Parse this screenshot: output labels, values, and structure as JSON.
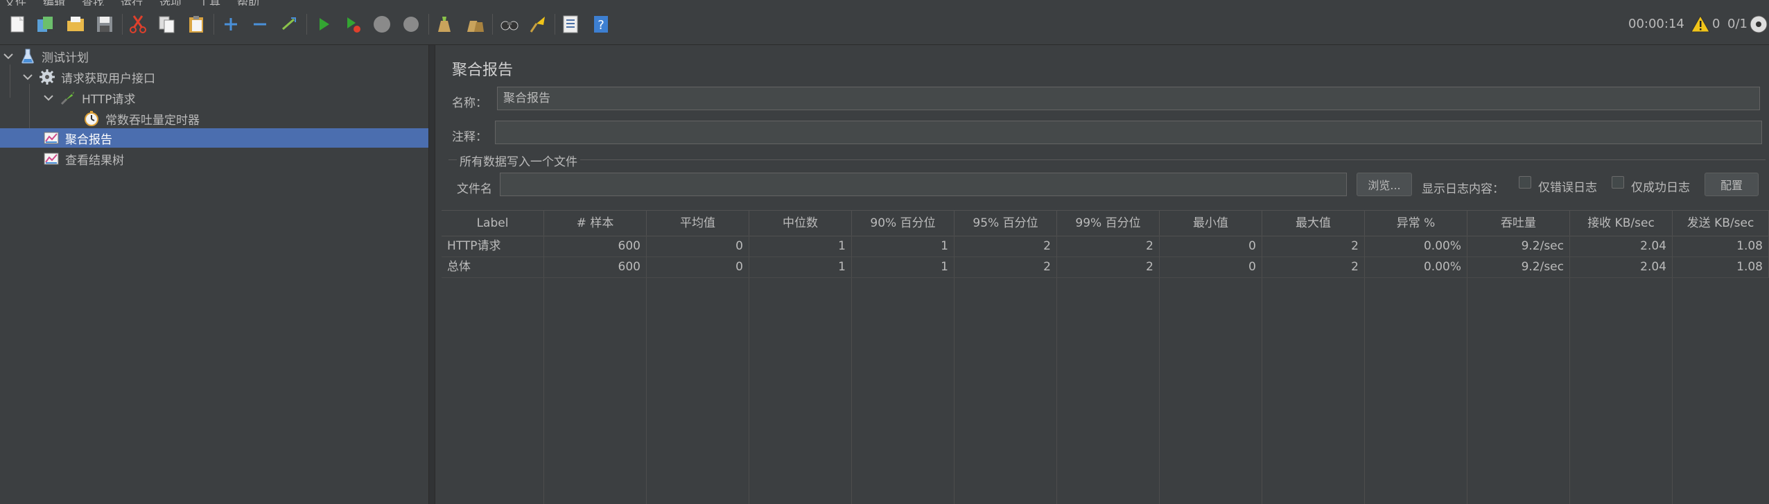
{
  "menu": [
    "文件",
    "编辑",
    "查找",
    "运行",
    "选项",
    "工具",
    "帮助"
  ],
  "toolbar": {
    "icons": [
      "new-icon",
      "templates-icon",
      "open-icon",
      "save-icon",
      "cut-icon",
      "copy-icon",
      "paste-icon",
      "expand-icon",
      "collapse-icon",
      "toggle-icon",
      "start-icon",
      "start-no-pause-icon",
      "stop-icon",
      "shutdown-icon",
      "clear-icon",
      "clear-all-icon",
      "search-icon",
      "reset-search-icon",
      "function-helper-icon",
      "help-icon"
    ]
  },
  "status": {
    "elapsed": "00:00:14",
    "warnings": "0",
    "threads": "0/1"
  },
  "tree": {
    "items": [
      {
        "label": "测试计划",
        "icon": "test-plan-icon"
      },
      {
        "label": "请求获取用户接口",
        "icon": "thread-group-icon"
      },
      {
        "label": "HTTP请求",
        "icon": "http-sampler-icon"
      },
      {
        "label": "常数吞吐量定时器",
        "icon": "timer-icon"
      },
      {
        "label": "聚合报告",
        "icon": "report-icon",
        "selected": true
      },
      {
        "label": "查看结果树",
        "icon": "report-icon"
      }
    ]
  },
  "panel": {
    "title": "聚合报告",
    "name_label": "名称：",
    "name_value": "聚合报告",
    "comment_label": "注释：",
    "comment_value": "",
    "file_group_title": "所有数据写入一个文件",
    "file_label": "文件名",
    "file_value": "",
    "browse_label": "浏览...",
    "log_label": "显示日志内容：",
    "errors_only_label": "仅错误日志",
    "success_only_label": "仅成功日志",
    "config_label": "配置"
  },
  "table": {
    "headers": [
      "Label",
      "# 样本",
      "平均值",
      "中位数",
      "90% 百分位",
      "95% 百分位",
      "99% 百分位",
      "最小值",
      "最大值",
      "异常 %",
      "吞吐量",
      "接收 KB/sec",
      "发送 KB/sec"
    ],
    "rows": [
      [
        "HTTP请求",
        "600",
        "0",
        "1",
        "1",
        "2",
        "2",
        "0",
        "2",
        "0.00%",
        "9.2/sec",
        "2.04",
        "1.08"
      ],
      [
        "总体",
        "600",
        "0",
        "1",
        "1",
        "2",
        "2",
        "0",
        "2",
        "0.00%",
        "9.2/sec",
        "2.04",
        "1.08"
      ]
    ]
  },
  "colors": {
    "background": "#3c3f41",
    "selection": "#4b6eaf",
    "text": "#bbbbbb"
  }
}
